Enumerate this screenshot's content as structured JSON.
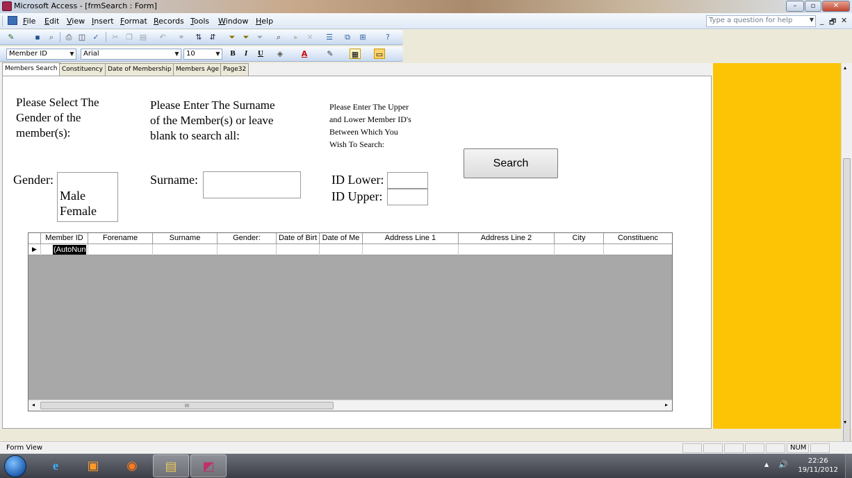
{
  "window": {
    "title": "Microsoft Access - [frmSearch : Form]",
    "minimize_glyph": "–",
    "maximize_glyph": "▫",
    "close_glyph": "✕"
  },
  "menubar": {
    "items": [
      "File",
      "Edit",
      "View",
      "Insert",
      "Format",
      "Records",
      "Tools",
      "Window",
      "Help"
    ],
    "help_placeholder": "Type a question for help",
    "mdi_minimize": "_",
    "mdi_restore": "🗗",
    "mdi_close": "✕"
  },
  "formatting_toolbar": {
    "object_combo": "Member ID",
    "font_combo": "Arial",
    "size_combo": "10",
    "bold": "B",
    "italic": "I",
    "underline": "U"
  },
  "tabs": [
    "Members Search",
    "Constituency",
    "Date of Membership",
    "Members Age",
    "Page32"
  ],
  "form": {
    "gender_prompt": [
      "Please Select The",
      "Gender of the",
      "member(s):"
    ],
    "surname_prompt": [
      "Please Enter The Surname",
      "of the Member(s) or leave",
      "blank to search all:"
    ],
    "id_prompt": [
      "Please Enter The Upper",
      "and Lower Member ID's",
      "Between Which You",
      "Wish To Search:"
    ],
    "gender_label": "Gender:",
    "gender_options": [
      "Male",
      "Female"
    ],
    "surname_label": "Surname:",
    "surname_value": "",
    "id_lower_label": "ID Lower:",
    "id_lower_value": "",
    "id_upper_label": "ID Upper:",
    "id_upper_value": "",
    "search_button": "Search"
  },
  "datasheet": {
    "columns": [
      "Member ID",
      "Forename",
      "Surname",
      "Gender:",
      "Date of Birt",
      "Date of Me",
      "Address Line 1",
      "Address Line 2",
      "City",
      "Constituenc"
    ],
    "new_row_value": "(AutoNun",
    "scroll_thumb_glyph": "III"
  },
  "statusbar": {
    "view": "Form View",
    "num": "NUM"
  },
  "taskbar": {
    "time": "22:26",
    "date": "19/11/2012"
  },
  "colors": {
    "side_panel": "#fcc404",
    "datasheet_bg": "#a8a8a8"
  }
}
